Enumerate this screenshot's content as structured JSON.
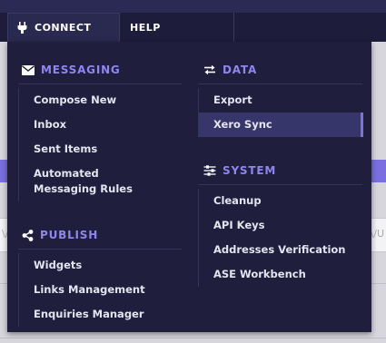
{
  "nav": {
    "connect_label": "CONNECT",
    "help_label": "HELP"
  },
  "menu": {
    "messaging": {
      "title": "MESSAGING",
      "items": [
        "Compose New",
        "Inbox",
        "Sent Items",
        "Automated Messaging Rules"
      ]
    },
    "publish": {
      "title": "PUBLISH",
      "items": [
        "Widgets",
        "Links Management",
        "Enquiries Manager"
      ]
    },
    "data": {
      "title": "DATA",
      "items": [
        "Export",
        "Xero Sync"
      ]
    },
    "system": {
      "title": "SYSTEM",
      "items": [
        "Cleanup",
        "API Keys",
        "Addresses Verification",
        "ASE Workbench"
      ]
    }
  },
  "colors": {
    "menu_bg": "#1f1e3d",
    "accent": "#8f86f0",
    "active_bg": "#37366a"
  }
}
